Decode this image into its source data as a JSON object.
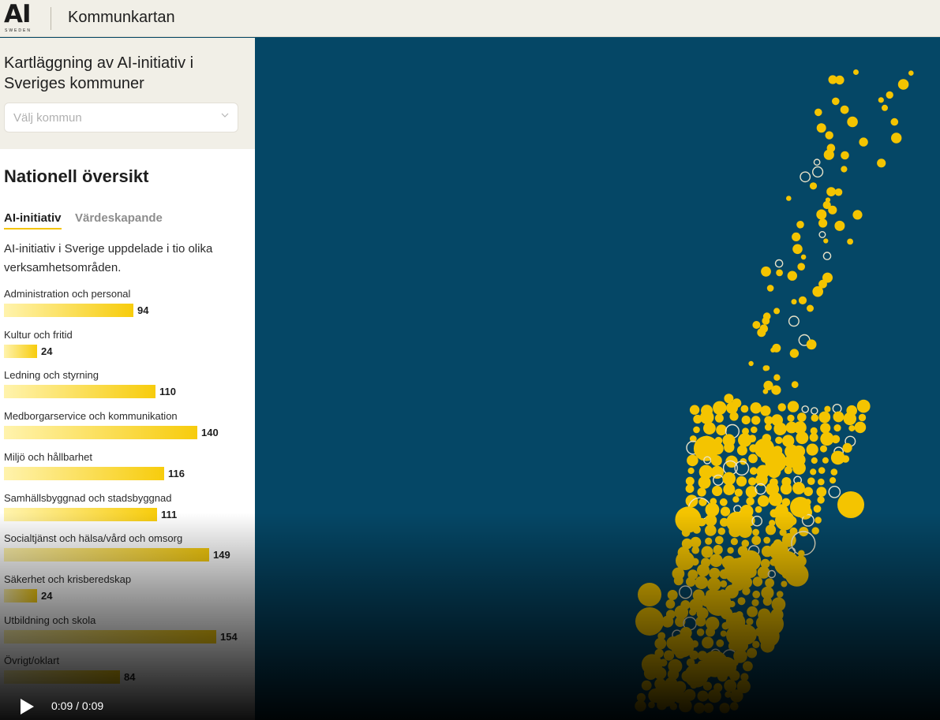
{
  "header": {
    "logo_text": "AI",
    "logo_subtext": "SWEDEN",
    "title": "Kommunkartan"
  },
  "sidebar": {
    "heading": "Kartläggning av AI-initiativ i Sveriges kommuner",
    "select_placeholder": "Välj kommun",
    "overview_title": "Nationell översikt",
    "tabs": [
      {
        "label": "AI-initiativ",
        "active": true
      },
      {
        "label": "Värdeskapande",
        "active": false
      }
    ],
    "intro": "AI-initiativ i Sverige uppdelade i tio olika verksamhetsområden.",
    "categories": [
      {
        "label": "Administration och personal",
        "value": 94
      },
      {
        "label": "Kultur och fritid",
        "value": 24
      },
      {
        "label": "Ledning och styrning",
        "value": 110
      },
      {
        "label": "Medborgarservice och kommunikation",
        "value": 140
      },
      {
        "label": "Miljö och hållbarhet",
        "value": 116
      },
      {
        "label": "Samhällsbyggnad och stadsbyggnad",
        "value": 111
      },
      {
        "label": "Socialtjänst och hälsa/vård och omsorg",
        "value": 149
      },
      {
        "label": "Säkerhet och krisberedskap",
        "value": 24
      },
      {
        "label": "Utbildning och skola",
        "value": 154
      },
      {
        "label": "Övrigt/oklart",
        "value": 84
      }
    ]
  },
  "player": {
    "time": "0:09 / 0:09",
    "play_icon": "play-icon"
  },
  "colors": {
    "map_background": "#054766",
    "accent_yellow": "#f4c400",
    "header_background": "#f1efe7"
  }
}
